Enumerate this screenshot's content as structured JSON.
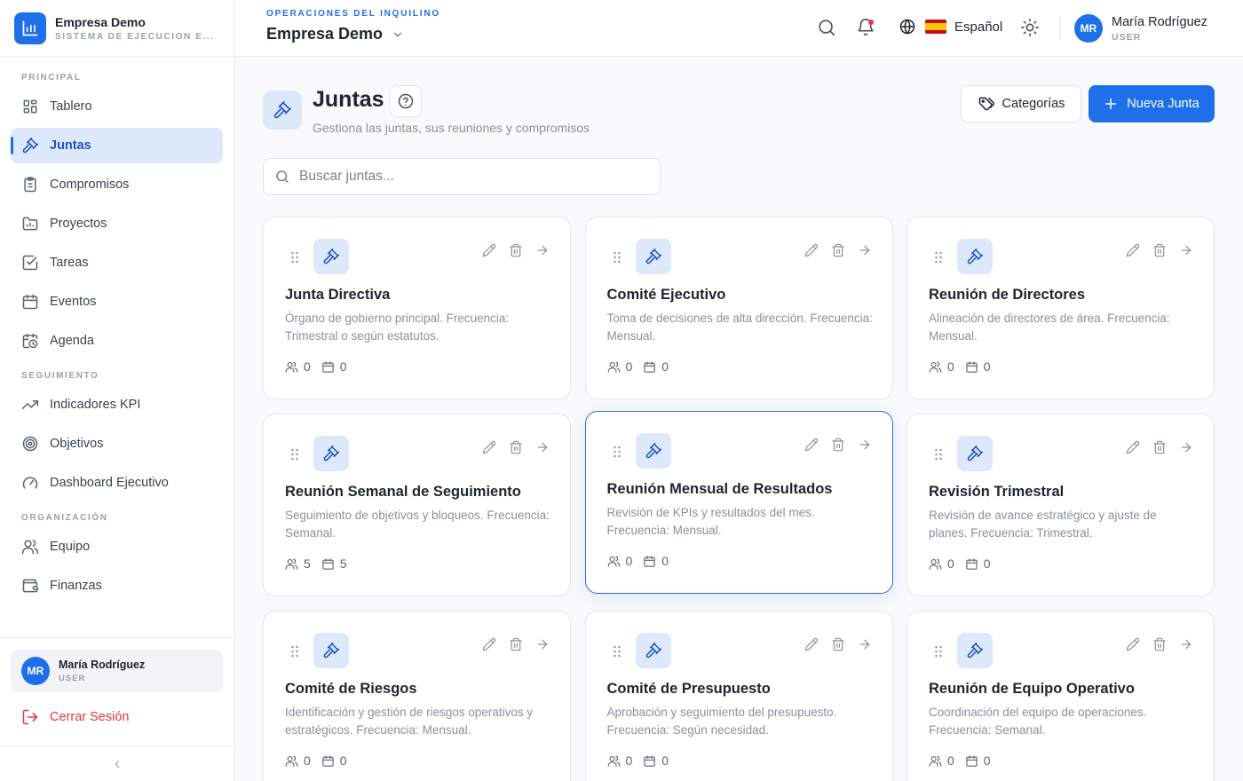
{
  "brand": {
    "name": "Empresa Demo",
    "subtitle": "SISTEMA DE EJECUCIÓN E..."
  },
  "sidebar": {
    "sections": [
      {
        "label": "PRINCIPAL"
      },
      {
        "label": "SEGUIMIENTO"
      },
      {
        "label": "ORGANIZACIÓN"
      }
    ],
    "items": [
      {
        "label": "Tablero",
        "icon": "grid-icon"
      },
      {
        "label": "Juntas",
        "icon": "gavel-icon",
        "active": true
      },
      {
        "label": "Compromisos",
        "icon": "clipboard-icon"
      },
      {
        "label": "Proyectos",
        "icon": "folder-icon"
      },
      {
        "label": "Tareas",
        "icon": "checkbox-icon"
      },
      {
        "label": "Eventos",
        "icon": "calendar-icon"
      },
      {
        "label": "Agenda",
        "icon": "calendar-clock-icon"
      },
      {
        "label": "Indicadores KPI",
        "icon": "trend-icon"
      },
      {
        "label": "Objetivos",
        "icon": "target-icon"
      },
      {
        "label": "Dashboard Ejecutivo",
        "icon": "gauge-icon"
      },
      {
        "label": "Equipo",
        "icon": "users-icon"
      },
      {
        "label": "Finanzas",
        "icon": "wallet-icon"
      }
    ],
    "user": {
      "initials": "MR",
      "name": "María Rodríguez",
      "role": "USER"
    },
    "logout_label": "Cerrar Sesión"
  },
  "topbar": {
    "tenant_label": "OPERACIONES DEL INQUILINO",
    "tenant_name": "Empresa Demo",
    "language": "Español",
    "user": {
      "initials": "MR",
      "name": "María Rodríguez",
      "role": "USER"
    }
  },
  "page": {
    "title": "Juntas",
    "subtitle": "Gestiona las juntas, sus reuniones y compromisos",
    "categories_button": "Categorías",
    "new_button": "Nueva Junta",
    "search_placeholder": "Buscar juntas..."
  },
  "boards": [
    {
      "title": "Junta Directiva",
      "description": "Órgano de gobierno principal. Frecuencia: Trimestral o según estatutos.",
      "members": "0",
      "meetings": "0"
    },
    {
      "title": "Comité Ejecutivo",
      "description": "Toma de decisiones de alta dirección. Frecuencia: Mensual.",
      "members": "0",
      "meetings": "0"
    },
    {
      "title": "Reunión de Directores",
      "description": "Alineación de directores de área. Frecuencia: Mensual.",
      "members": "0",
      "meetings": "0"
    },
    {
      "title": "Reunión Semanal de Seguimiento",
      "description": "Seguimiento de objetivos y bloqueos. Frecuencia: Semanal.",
      "members": "5",
      "meetings": "5"
    },
    {
      "title": "Reunión Mensual de Resultados",
      "description": "Revisión de KPIs y resultados del mes. Frecuencia: Mensual.",
      "members": "0",
      "meetings": "0",
      "highlight": true
    },
    {
      "title": "Revisión Trimestral",
      "description": "Revisión de avance estratégico y ajuste de planes. Frecuencia: Trimestral.",
      "members": "0",
      "meetings": "0"
    },
    {
      "title": "Comité de Riesgos",
      "description": "Identificación y gestión de riesgos operativos y estratégicos. Frecuencia: Mensual.",
      "members": "0",
      "meetings": "0"
    },
    {
      "title": "Comité de Presupuesto",
      "description": "Aprobación y seguimiento del presupuesto. Frecuencia: Según necesidad.",
      "members": "0",
      "meetings": "0"
    },
    {
      "title": "Reunión de Equipo Operativo",
      "description": "Coordinación del equipo de operaciones. Frecuencia: Semanal.",
      "members": "0",
      "meetings": "0"
    }
  ],
  "colors": {
    "accent": "#1f6feb",
    "accent_soft": "#dde9fb",
    "danger": "#e5383b"
  }
}
